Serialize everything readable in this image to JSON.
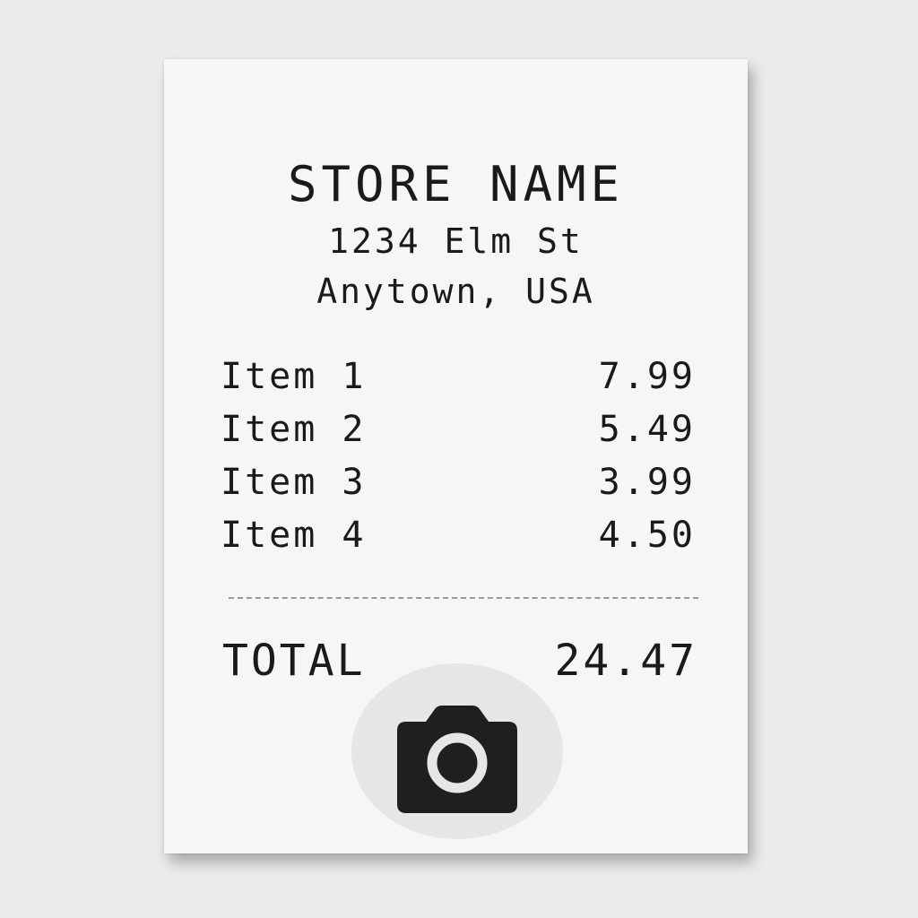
{
  "receipt": {
    "store_name": "STORE NAME",
    "address_line_1": "1234 Elm St",
    "address_line_2": "Anytown, USA",
    "items": [
      {
        "label": "Item 1",
        "price": "7.99"
      },
      {
        "label": "Item 2",
        "price": "5.49"
      },
      {
        "label": "Item 3",
        "price": "3.99"
      },
      {
        "label": "Item 4",
        "price": "4.50"
      }
    ],
    "total_label": "TOTAL",
    "total_value": "24.47"
  },
  "camera_button": {
    "icon": "camera-icon",
    "icon_color": "#1f1f1f",
    "background_color": "#e6e6e6"
  }
}
